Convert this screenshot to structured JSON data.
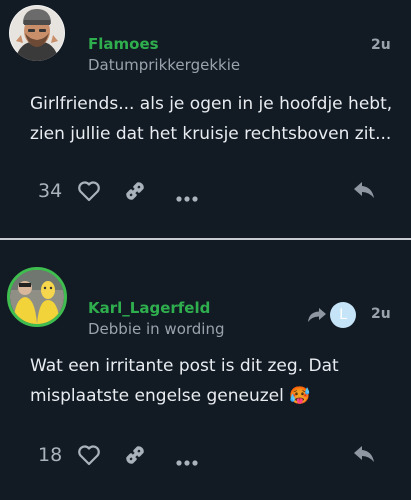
{
  "posts": [
    {
      "username": "Flamoes",
      "user_title": "Datumprikkergekkie",
      "time": "2u",
      "body_line1": "Girlfriends... als je ogen in je hoofdje hebt,",
      "body_line2": "zien jullie dat het kruisje rechtsboven zit...",
      "like_count": "34"
    },
    {
      "username": "Karl_Lagerfeld",
      "user_title": "Debbie in wording",
      "time": "2u",
      "reply_to_initial": "L",
      "body_line1": "Wat een irritante post is dit zeg. Dat",
      "body_line2": "misplaatste engelse geneuzel",
      "body_emoji": "🥵",
      "like_count": "18"
    }
  ],
  "colors": {
    "background": "#121a24",
    "username": "#2fae4e",
    "avatar_ring": "#3fbe4f",
    "muted": "#9aa3ad",
    "divider": "#c9cdd2"
  },
  "icons": [
    "heart-icon",
    "link-icon",
    "more-icon",
    "reply-icon",
    "reply-arrow-icon"
  ]
}
